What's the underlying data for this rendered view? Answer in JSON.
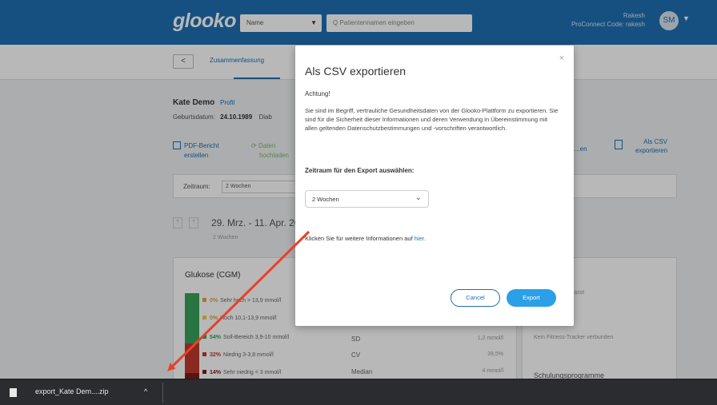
{
  "header": {
    "logo": "glooko",
    "name_select": "Name",
    "search_placeholder": "Q Patientennamen eingeben",
    "user_name": "Rakesh",
    "user_sub": "ProConnect Code: rakesh",
    "avatar": "SM"
  },
  "nav": {
    "back": "<",
    "summary_tab": "Zusammenfassung"
  },
  "patient": {
    "name": "Kate Demo",
    "profile_link": "Profil",
    "dob_label": "Geburtsdatum:",
    "dob_value": "24.10.1989",
    "dob_extra": "Diab"
  },
  "actions": {
    "pdf_line1": "PDF-Bericht",
    "pdf_line2": "erstellen",
    "sync_line1": "Daten",
    "sync_line2": "hochladen",
    "right_link": "...en",
    "csv_line1": "Als CSV",
    "csv_line2": "exportieren"
  },
  "filter": {
    "label": "Zeitraum:",
    "value": "2 Wochen"
  },
  "date": {
    "range": "29. Mrz. - 11. Apr. 20",
    "sub": "2 Wochen"
  },
  "glucose": {
    "title": "Glukose (CGM)",
    "legend": [
      {
        "pct": "0%",
        "label": "Sehr hoch > 13,9 mmol/l",
        "color": "#e8a23a"
      },
      {
        "pct": "0%",
        "label": "Hoch 10,1-13,9 mmol/l",
        "color": "#f2c94c"
      },
      {
        "pct": "54%",
        "label": "Soll-Bereich 3,9-10 mmol/l",
        "color": "#3aa35a"
      },
      {
        "pct": "32%",
        "label": "Niedrig 3-3,8 mmol/l",
        "color": "#c0392b"
      },
      {
        "pct": "14%",
        "label": "Sehr niedrig < 3 mmol/l",
        "color": "#7b1e1e"
      }
    ],
    "bar_fractions": {
      "in_range": 0.54,
      "low": 0.32,
      "very_low": 0.14
    },
    "stats": [
      {
        "label": "SD",
        "value": "1,2 mmol/l"
      },
      {
        "label": "CV",
        "value": "28,5%"
      },
      {
        "label": "Median",
        "value": "4 mmol/l"
      }
    ]
  },
  "right_card": {
    "text1": "...ergebnisse erfasst",
    "text2": "Kein Fitness-Tracker verbunden",
    "title3": "Schulungsprogramme"
  },
  "modal": {
    "close": "×",
    "title": "Als CSV exportieren",
    "warning": "Achtung!",
    "body": "Sie sind im Begriff, vertrauliche Gesundheitsdaten von der Glooko-Plattform zu exportieren. Sie sind für die Sicherheit dieser Informationen und deren Verwendung in Übereinstimmung mit allen geltenden Datenschutzbestimmungen und -vorschriften verantwortlich.",
    "period_label": "Zeitraum für den Export auswählen:",
    "period_value": "2 Wochen",
    "more_info_prefix": "Klicken Sie für weitere Informationen auf",
    "more_info_link": "hier",
    "more_info_suffix": ".",
    "cancel": "Cancel",
    "export": "Export"
  },
  "download_bar": {
    "file_name": "export_Kate Dem....zip",
    "caret": "^"
  },
  "colors": {
    "header_blue": "#1f6fb2",
    "accent_blue": "#2b9fe8",
    "arrow_red": "#e8402a"
  }
}
